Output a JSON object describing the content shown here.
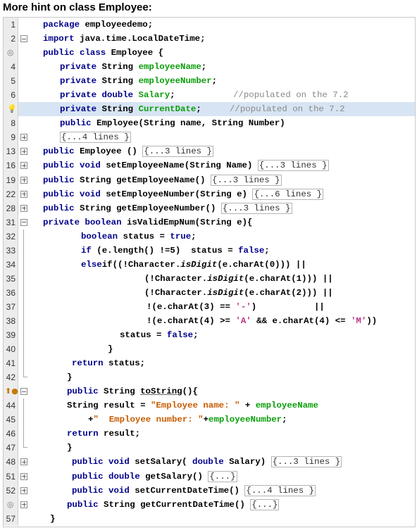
{
  "heading": "More hint on class Employee:",
  "line_numbers": [
    "1",
    "2",
    "",
    "4",
    "5",
    "6",
    "",
    "8",
    "9",
    "13",
    "16",
    "19",
    "22",
    "28",
    "31",
    "32",
    "33",
    "34",
    "35",
    "36",
    "37",
    "38",
    "39",
    "40",
    "41",
    "42",
    "",
    "44",
    "45",
    "46",
    "47",
    "48",
    "51",
    "52",
    "",
    "57"
  ],
  "code": {
    "l1_kw": "package",
    "l1_rest": " employeedemo;",
    "l2_kw": "import",
    "l2_rest": " java.time.LocalDateTime;",
    "l3_kw": "public class",
    "l3_rest": " Employee {",
    "l4_kw": "private",
    "l4_type": " String ",
    "l4_fld": "employeeName",
    "l4_end": ";",
    "l5_kw": "private",
    "l5_type": " String ",
    "l5_fld": "employeeNumber",
    "l5_end": ";",
    "l6_kw": "private double",
    "l6_fld": " Salary",
    "l6_end": ";",
    "l6_cmt": "//populated on the 7.2",
    "l7_kw": "private",
    "l7_type": " String ",
    "l7_fld": "CurrentDate",
    "l7_end": ";",
    "l7_cmt": "//populated on the 7.2",
    "l8_kw": "public",
    "l8_rest": " Employee(String name, String Number)",
    "l9_coll": "{...4 lines }",
    "l13_kw": "public",
    "l13_rest": " Employee () ",
    "l13_coll": "{...3 lines }",
    "l16_kw": "public void",
    "l16_rest": " setEmployeeName(String Name) ",
    "l16_coll": "{...3 lines }",
    "l19_kw": "public",
    "l19_rest": " String getEmployeeName() ",
    "l19_coll": "{...3 lines }",
    "l22_kw": "public void",
    "l22_rest": " setEmployeeNumber(String e) ",
    "l22_coll": "{...6 lines }",
    "l28_kw": "public",
    "l28_rest": " String getEmployeeNumber() ",
    "l28_coll": "{...3 lines }",
    "l31_kw": "private boolean",
    "l31_rest": " isValidEmpNum(String e){",
    "l32_kw": "boolean",
    "l32_mid": " status = ",
    "l32_kw2": "true",
    "l32_end": ";",
    "l33_kw": "if",
    "l33_mid": " (e.length() !=5)  status = ",
    "l33_kw2": "false",
    "l33_end": ";",
    "l34_kw": "else",
    "l34_a": "if((!Character.",
    "l34_it": "isDigit",
    "l34_b": "(e.charAt(0))) ||",
    "l35_a": "(!Character.",
    "l35_it": "isDigit",
    "l35_b": "(e.charAt(1))) ||",
    "l36_a": "(!Character.",
    "l36_it": "isDigit",
    "l36_b": "(e.charAt(2))) ||",
    "l37_a": "!(e.charAt(3) == ",
    "l37_chr": "'-'",
    "l37_b": ")           ||",
    "l38_a": "!(e.charAt(4) >= ",
    "l38_chr1": "'A'",
    "l38_b": " && e.charAt(4) <= ",
    "l38_chr2": "'M'",
    "l38_c": "))",
    "l39_a": "status = ",
    "l39_kw": "false",
    "l39_end": ";",
    "l40": "}",
    "l41_kw": "return",
    "l41_rest": " status;",
    "l42": "}",
    "l43_kw": "public",
    "l43_a": " String ",
    "l43_ul": "toString",
    "l43_b": "(){",
    "l44_a": "String result = ",
    "l44_str": "\"Employee name: \"",
    "l44_b": " + ",
    "l44_fld": "employeeName",
    "l45_a": "+",
    "l45_str": "\"  Employee number: \"",
    "l45_b": "+",
    "l45_fld": "employeeNumber",
    "l45_end": ";",
    "l46_kw": "return",
    "l46_rest": " result;",
    "l47": "}",
    "l48_kw": "public void",
    "l48_a": " setSalary( ",
    "l48_kw2": "double",
    "l48_b": " Salary) ",
    "l48_coll": "{...3 lines }",
    "l51_kw": "public double",
    "l51_a": " getSalary() ",
    "l51_coll": "{...}",
    "l52_kw": "public void",
    "l52_a": " setCurrentDateTime() ",
    "l52_coll": "{...4 lines }",
    "l53_kw": "public",
    "l53_a": " String getCurrentDateTime() ",
    "l53_coll": "{...}",
    "l57": "}"
  },
  "gutter_icons": {
    "line3": "override-marker-icon",
    "line7": "lightbulb-hint-icon",
    "line43": "override-up-arrow-icon",
    "line53": "override-marker-icon"
  },
  "colors": {
    "keyword": "#00008b",
    "field": "#0a9e0a",
    "string": "#c75c00",
    "char": "#b8368c",
    "comment": "#8a8a8a",
    "highlight": "#d7e4f3",
    "gutter": "#ececec"
  }
}
